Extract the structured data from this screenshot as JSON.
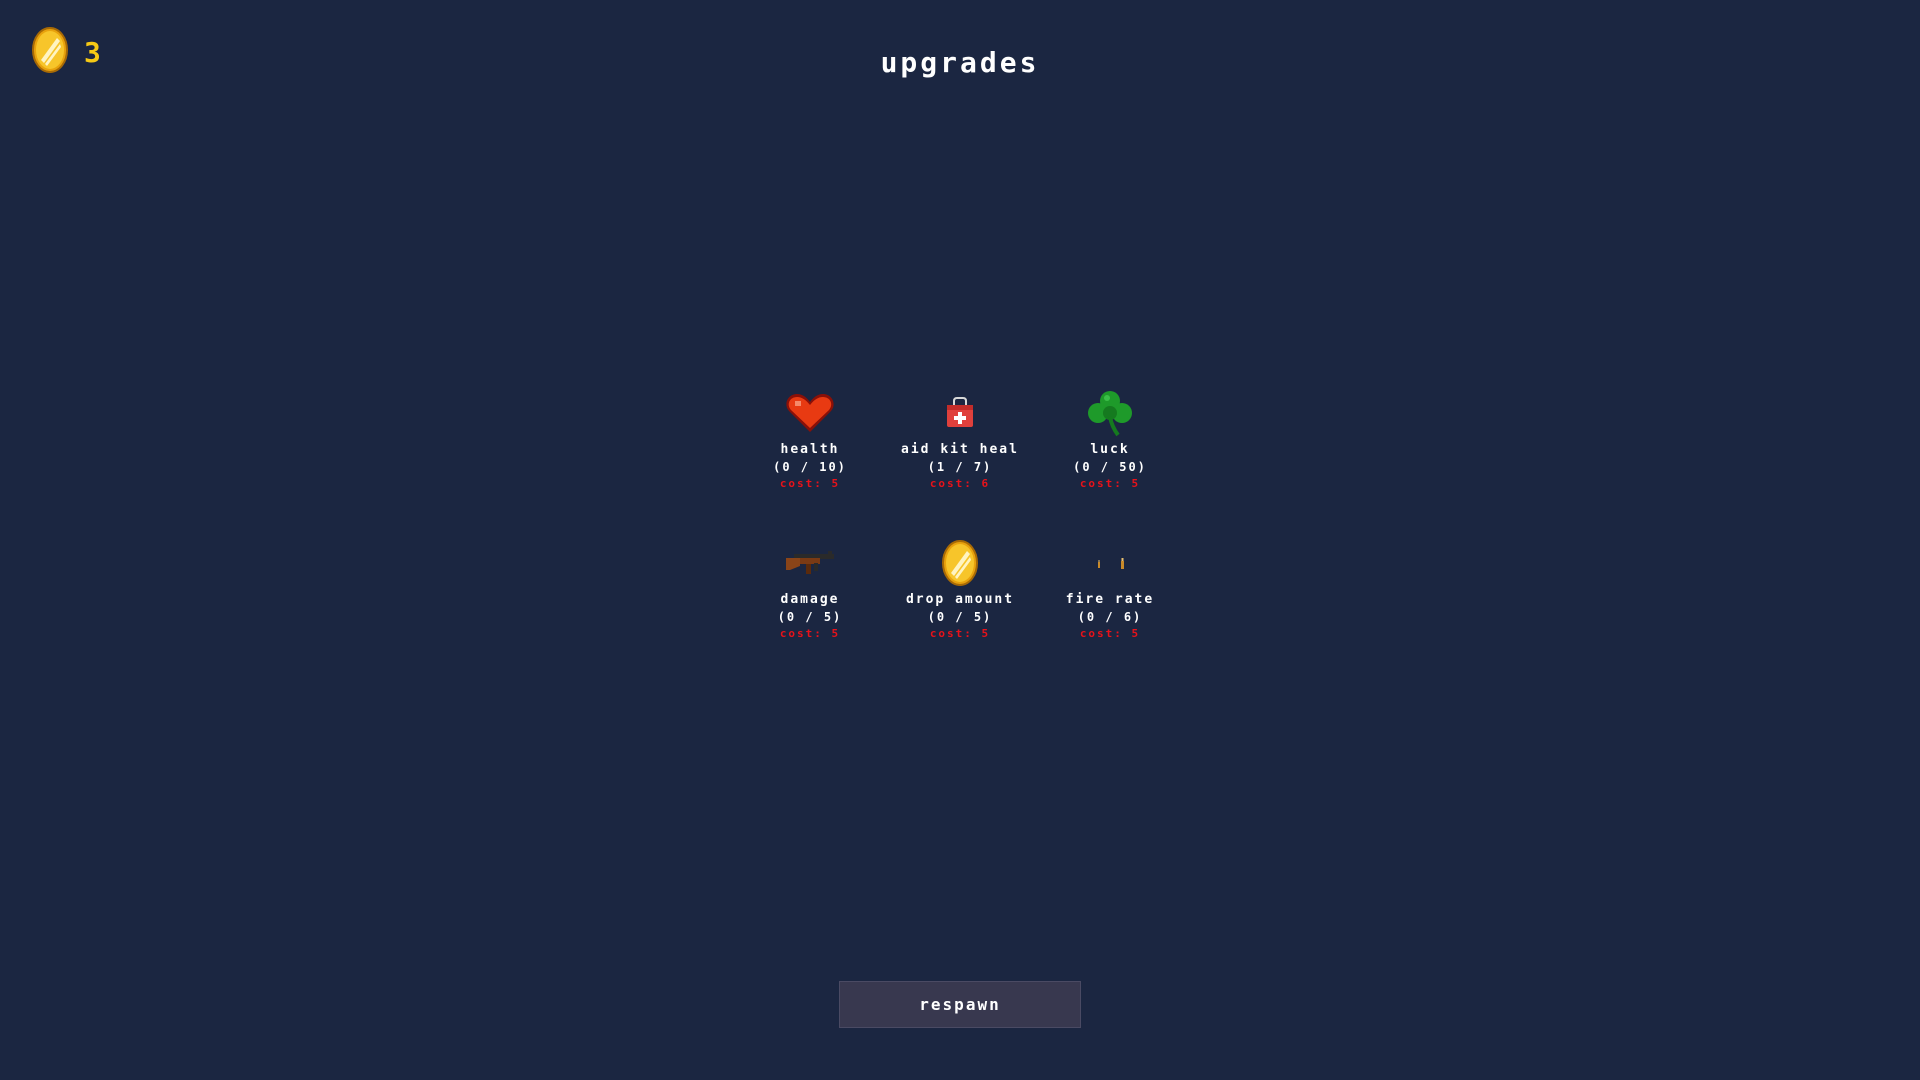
{
  "hud": {
    "coins": "3",
    "coin_icon": "gold-coin-icon"
  },
  "title": "upgrades",
  "upgrades": [
    {
      "name": "health",
      "level": "(0 / 10)",
      "cost": "cost: 5",
      "icon": "heart-icon"
    },
    {
      "name": "aid kit heal",
      "level": "(1 / 7)",
      "cost": "cost: 6",
      "icon": "first-aid-kit-icon"
    },
    {
      "name": "luck",
      "level": "(0 / 50)",
      "cost": "cost: 5",
      "icon": "clover-icon"
    },
    {
      "name": "damage",
      "level": "(0 / 5)",
      "cost": "cost: 5",
      "icon": "gun-icon"
    },
    {
      "name": "drop amount",
      "level": "(0 / 5)",
      "cost": "cost: 5",
      "icon": "gold-coin-icon"
    },
    {
      "name": "fire rate",
      "level": "(0 / 6)",
      "cost": "cost: 5",
      "icon": "bullets-icon"
    }
  ],
  "respawn_label": "respawn",
  "colors": {
    "background": "#1b2641",
    "coin": "#f6c915",
    "cost": "#e8121a",
    "button": "#38384f"
  }
}
